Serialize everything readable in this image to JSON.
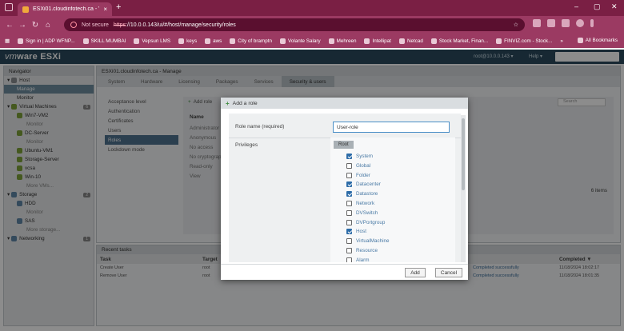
{
  "browser": {
    "tab_title": "ESXi01.cloudinfotech.ca - VMw...",
    "new_tab": "+",
    "not_secure": "Not secure",
    "url_scheme": "https",
    "url_rest": "://10.0.0.143/ui/#/host/manage/security/roles",
    "bookmarks": [
      "Sign in | ADP WFNP...",
      "SKILL MUMBAI",
      "Vepsun LMS",
      "keys",
      "aws",
      "City of bramptn",
      "Volante Salary",
      "Mehreen",
      "Intellipat",
      "Netcad",
      "Stock Market, Finan...",
      "FINVIZ.com - Stock..."
    ],
    "bookmarks_more": "»",
    "all_bookmarks": "All Bookmarks"
  },
  "esxi": {
    "brand_vm": "vm",
    "brand_rest": "ware ESXi",
    "user": "root@10.0.0.143 ▾",
    "help": "Help ▾"
  },
  "navigator": {
    "title": "Navigator",
    "items": [
      {
        "label": "Host",
        "level": 0,
        "icon": "host-icon"
      },
      {
        "label": "Manage",
        "level": 1,
        "selected": true
      },
      {
        "label": "Monitor",
        "level": 1
      },
      {
        "label": "Virtual Machines",
        "level": 0,
        "icon": "vm-icon",
        "badge": "6"
      },
      {
        "label": "Win7-VM2",
        "level": 1,
        "icon": "vm-icon"
      },
      {
        "label": "Monitor",
        "level": 2
      },
      {
        "label": "DC-Server",
        "level": 1,
        "icon": "vm-icon"
      },
      {
        "label": "Monitor",
        "level": 2
      },
      {
        "label": "Ubuntu-VM1",
        "level": 1,
        "icon": "vm-icon"
      },
      {
        "label": "Storage-Server",
        "level": 1,
        "icon": "vm-icon"
      },
      {
        "label": "vcsa",
        "level": 1,
        "icon": "vm-icon"
      },
      {
        "label": "Win-10",
        "level": 1,
        "icon": "vm-icon"
      },
      {
        "label": "More VMs...",
        "level": 2
      },
      {
        "label": "Storage",
        "level": 0,
        "icon": "storage-icon",
        "badge": "2"
      },
      {
        "label": "HDD",
        "level": 1,
        "icon": "disk-icon"
      },
      {
        "label": "Monitor",
        "level": 2
      },
      {
        "label": "SAS",
        "level": 1,
        "icon": "disk-icon"
      },
      {
        "label": "More storage...",
        "level": 2
      },
      {
        "label": "Networking",
        "level": 0,
        "icon": "network-icon",
        "badge": "1"
      }
    ]
  },
  "main": {
    "title": "ESXi01.cloudinfotech.ca - Manage",
    "tabs": [
      "System",
      "Hardware",
      "Licensing",
      "Packages",
      "Services",
      "Security & users"
    ],
    "active_tab": 5,
    "left_items": [
      "Acceptance level",
      "Authentication",
      "Certificates",
      "Users",
      "Roles",
      "Lockdown mode"
    ],
    "left_selected": 4,
    "toolbar_add": "Add role",
    "search_placeholder": "Search",
    "column_name": "Name",
    "roles": [
      "Administrator",
      "Anonymous",
      "No access",
      "No cryptography...",
      "Read-only",
      "View"
    ],
    "items_count": "6 items"
  },
  "tasks": {
    "title": "Recent tasks",
    "headers": [
      "Task",
      "Target",
      "Completed ▼"
    ],
    "rows": [
      {
        "task": "Create User",
        "target": "root",
        "status": "Completed successfully",
        "completed": "11/18/2024 18:02:17"
      },
      {
        "task": "Remove User",
        "target": "root",
        "status": "Completed successfully",
        "completed": "11/18/2024 18:01:35"
      }
    ]
  },
  "dialog": {
    "title": "Add a role",
    "role_name_label": "Role name (required)",
    "role_name_value": "User-role",
    "privileges_label": "Privileges",
    "root_label": "Root",
    "privileges": [
      {
        "label": "System",
        "checked": true
      },
      {
        "label": "Global",
        "checked": false
      },
      {
        "label": "Folder",
        "checked": false
      },
      {
        "label": "Datacenter",
        "checked": true
      },
      {
        "label": "Datastore",
        "checked": true
      },
      {
        "label": "Network",
        "checked": false
      },
      {
        "label": "DVSwitch",
        "checked": false
      },
      {
        "label": "DVPortgroup",
        "checked": false
      },
      {
        "label": "Host",
        "checked": true
      },
      {
        "label": "VirtualMachine",
        "checked": false
      },
      {
        "label": "Resource",
        "checked": false
      },
      {
        "label": "Alarm",
        "checked": false
      }
    ],
    "add_button": "Add",
    "cancel_button": "Cancel"
  },
  "colors": {
    "browser_frame": "#9b3a62",
    "esxi_header": "#2b4a5d",
    "accent_blue": "#2d6ca8"
  }
}
